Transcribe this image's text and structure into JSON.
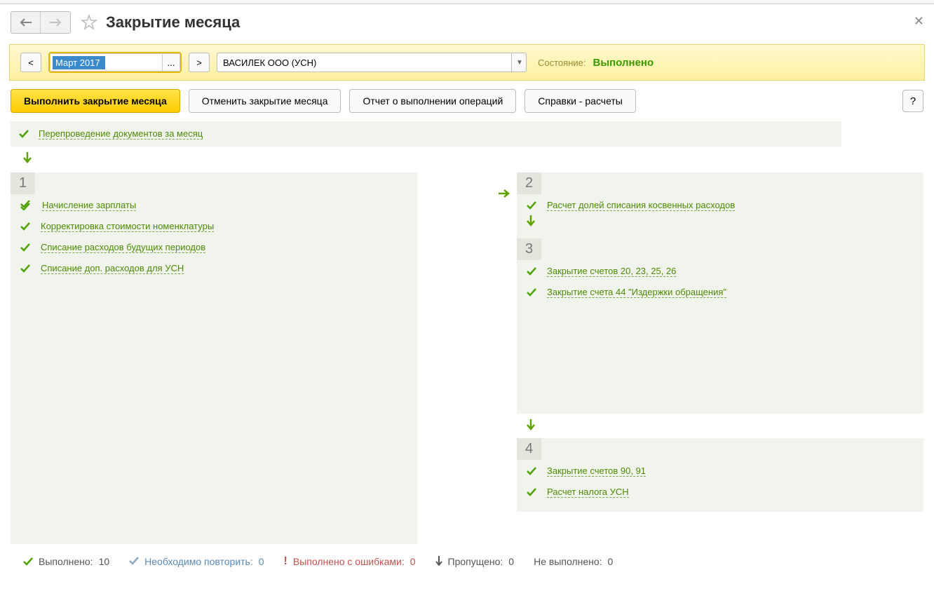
{
  "page_title": "Закрытие месяца",
  "period": "Март 2017",
  "prev_btn": "<",
  "next_btn": ">",
  "dots": "...",
  "org": "ВАСИЛЕК ООО (УСН)",
  "state_label": "Состояние:",
  "state_value": "Выполнено",
  "toolbar": {
    "execute": "Выполнить закрытие месяца",
    "cancel": "Отменить закрытие месяца",
    "report": "Отчет о выполнении операций",
    "refs": "Справки - расчеты",
    "help": "?"
  },
  "repost": "Перепроведение документов за месяц",
  "block1": {
    "num": "1",
    "ops": [
      "Начисление зарплаты",
      "Корректировка стоимости номенклатуры",
      "Списание расходов будущих периодов",
      "Списание доп. расходов для УСН"
    ]
  },
  "block2": {
    "num": "2",
    "ops": [
      "Расчет долей списания косвенных расходов"
    ]
  },
  "block3": {
    "num": "3",
    "ops": [
      "Закрытие счетов 20, 23, 25, 26",
      "Закрытие счета 44 \"Издержки обращения\""
    ]
  },
  "block4": {
    "num": "4",
    "ops": [
      "Закрытие счетов 90, 91",
      "Расчет налога УСН"
    ]
  },
  "footer": {
    "done_label": "Выполнено:",
    "done_val": "10",
    "repeat_label": "Необходимо повторить:",
    "repeat_val": "0",
    "err_label": "Выполнено с ошибками:",
    "err_val": "0",
    "skip_label": "Пропущено:",
    "skip_val": "0",
    "not_label": "Не выполнено:",
    "not_val": "0"
  }
}
